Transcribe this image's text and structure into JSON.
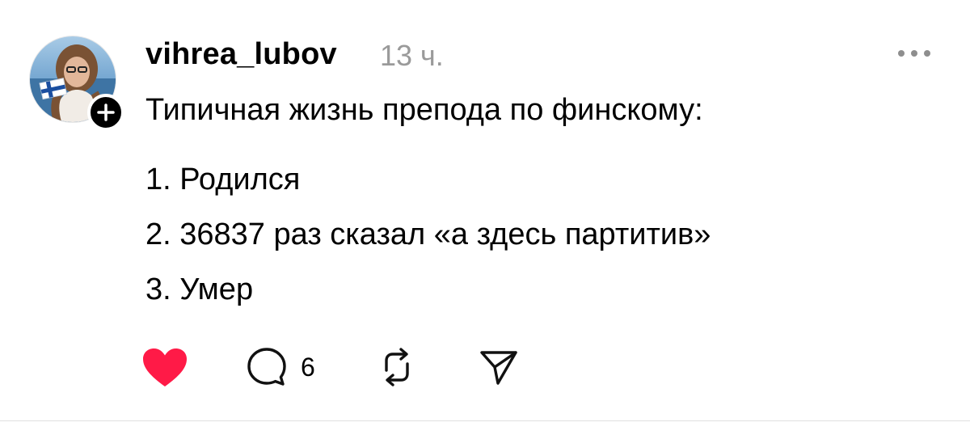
{
  "post": {
    "author": {
      "username": "vihrea_lubov",
      "time": "13 ч."
    },
    "text": {
      "intro": "Типичная жизнь препода по финскому:",
      "items": [
        "1. Родился",
        "2. 36837 раз сказал «а здесь партитив»",
        "3. Умер"
      ]
    },
    "actions": {
      "comment_count": "6"
    },
    "icons": {
      "like": "heart-icon",
      "comment": "comment-bubble-icon",
      "repost": "repost-icon",
      "share": "send-icon",
      "more": "more-dots-icon",
      "follow": "plus-icon"
    },
    "colors": {
      "like_active": "#ff1a47",
      "secondary_text": "#9a9a9a",
      "icon": "#111111"
    }
  }
}
